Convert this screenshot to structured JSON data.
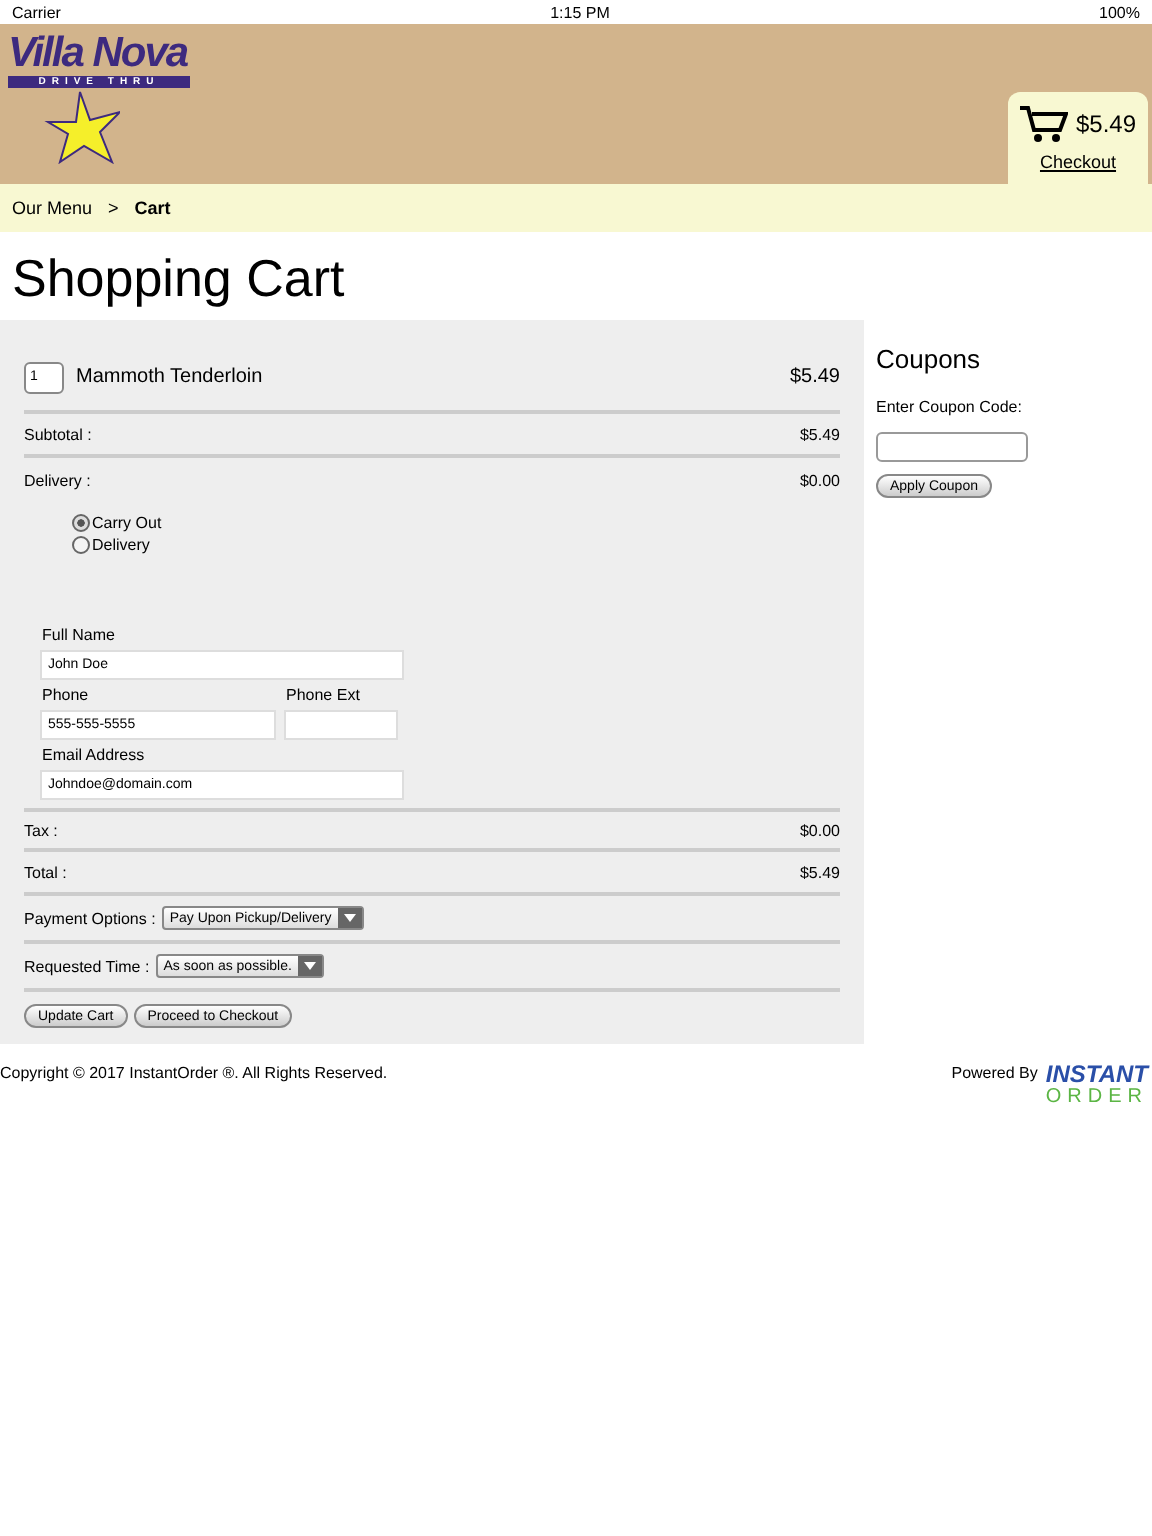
{
  "status_bar": {
    "carrier": "Carrier",
    "time": "1:15 PM",
    "battery": "100%"
  },
  "header": {
    "logo": {
      "name": "Villa Nova",
      "tagline": "DRIVE THRU"
    },
    "cart": {
      "total": "$5.49",
      "link": "Checkout"
    }
  },
  "breadcrumb": [
    {
      "label": "Our Menu",
      "selected": false
    },
    {
      "label": ">",
      "selected": false
    },
    {
      "label": "Cart",
      "selected": true
    }
  ],
  "title": "Shopping Cart",
  "cart": {
    "items": [
      {
        "qty": "1",
        "name": "Mammoth Tenderloin",
        "price": "$5.49"
      }
    ],
    "subtotal": {
      "label": "Subtotal :",
      "value": "$5.49"
    },
    "delivery": {
      "label": "Delivery :",
      "value": "$0.00"
    },
    "order_types": [
      {
        "label": "Carry Out",
        "selected": true
      },
      {
        "label": "Delivery",
        "selected": false
      }
    ],
    "fields": {
      "full_name": {
        "label": "Full Name",
        "value": "John Doe"
      },
      "phone": {
        "label": "Phone",
        "value": "555-555-5555"
      },
      "phone_ext": {
        "label": "Phone Ext"
      },
      "email": {
        "label": "Email Address",
        "value": "Johndoe@domain.com"
      }
    },
    "tax": {
      "label": "Tax :",
      "value": "$0.00"
    },
    "total": {
      "label": "Total :",
      "value": "$5.49"
    },
    "payment": {
      "label": "Payment Options :",
      "value": "Pay Upon Pickup/Delivery"
    },
    "time": {
      "label": "Requested Time :",
      "value": "As soon as possible."
    },
    "buttons": [
      "Update Cart",
      "Proceed to Checkout"
    ]
  },
  "coupons": {
    "title": "Coupons",
    "label": "Enter Coupon Code:",
    "button": "Apply Coupon"
  },
  "footer": {
    "copyright": "Copyright © 2017 InstantOrder ®. All Rights Reserved.",
    "powered_by": "Powered By",
    "logo_top": "INSTANT",
    "logo_bottom": "ORDER"
  }
}
